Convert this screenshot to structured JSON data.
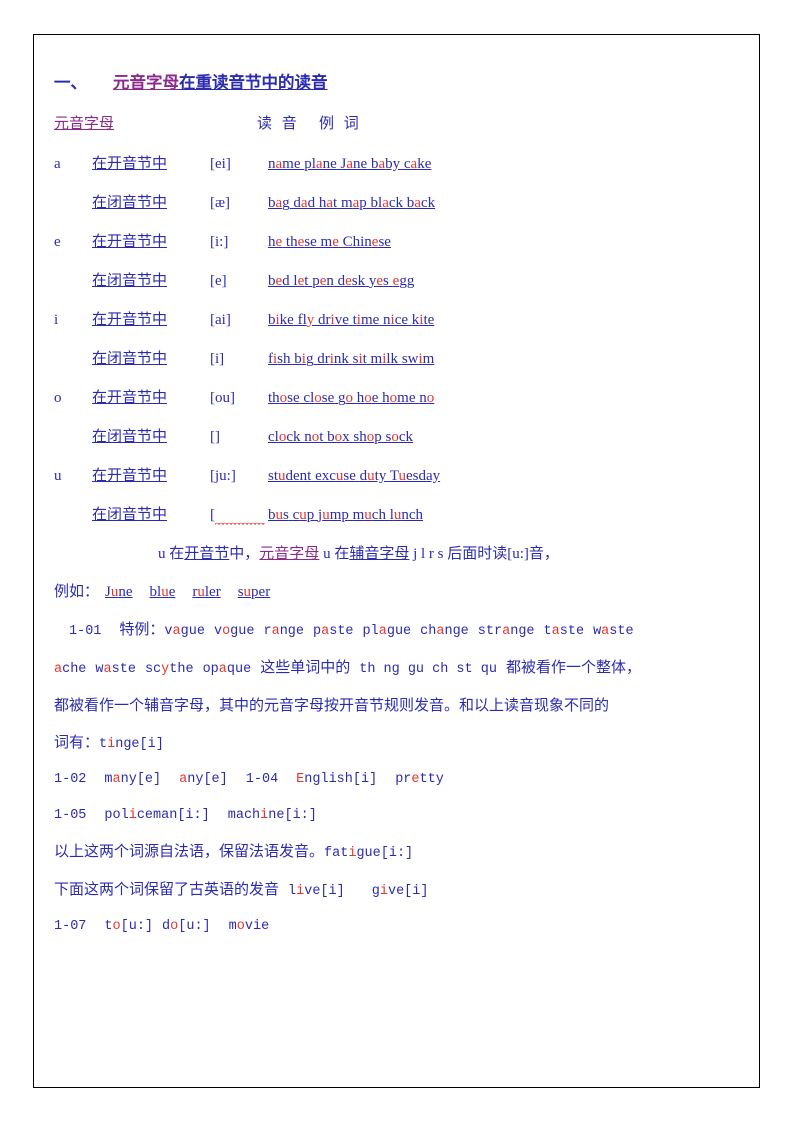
{
  "colors": {
    "blue": "#2b2bb0",
    "red": "#e8352b",
    "purple": "#8b2a8b",
    "border": "#000000",
    "background": "#ffffff"
  },
  "heading": {
    "number": "一、",
    "underlined_part": "元音字母",
    "rest": "在重读音节中的读音"
  },
  "table_header": {
    "vowel_letter": "元音字母",
    "reading": "读 音",
    "example": "例 词"
  },
  "rows": [
    {
      "letter": "a",
      "syllable": "在开音节中",
      "phonetic": "[ei]",
      "examples": [
        {
          "pre": "n",
          "hl": "a",
          "post": "me"
        },
        {
          "pre": "pl",
          "hl": "a",
          "post": "ne"
        },
        {
          "pre": "J",
          "hl": "a",
          "post": "ne"
        },
        {
          "pre": "b",
          "hl": "a",
          "post": "by"
        },
        {
          "pre": "c",
          "hl": "a",
          "post": "ke"
        }
      ]
    },
    {
      "letter": "",
      "syllable": "在闭音节中",
      "phonetic": "[æ]",
      "examples": [
        {
          "pre": "b",
          "hl": "a",
          "post": "g"
        },
        {
          "pre": "d",
          "hl": "a",
          "post": "d"
        },
        {
          "pre": "h",
          "hl": "a",
          "post": "t"
        },
        {
          "pre": "m",
          "hl": "a",
          "post": "p"
        },
        {
          "pre": "bl",
          "hl": "a",
          "post": "ck"
        },
        {
          "pre": "b",
          "hl": "a",
          "post": "ck"
        }
      ]
    },
    {
      "letter": "e",
      "syllable": "在开音节中",
      "phonetic": "[i:]",
      "examples": [
        {
          "pre": "h",
          "hl": "e",
          "post": ""
        },
        {
          "pre": "th",
          "hl": "e",
          "post": "se"
        },
        {
          "pre": "m",
          "hl": "e",
          "post": ""
        },
        {
          "pre": "Chin",
          "hl": "e",
          "post": "se"
        }
      ]
    },
    {
      "letter": "",
      "syllable": "在闭音节中",
      "phonetic": "[e]",
      "examples": [
        {
          "pre": "b",
          "hl": "e",
          "post": "d"
        },
        {
          "pre": "l",
          "hl": "e",
          "post": "t"
        },
        {
          "pre": "p",
          "hl": "e",
          "post": "n"
        },
        {
          "pre": "d",
          "hl": "e",
          "post": "sk"
        },
        {
          "pre": "y",
          "hl": "e",
          "post": "s"
        },
        {
          "pre": "",
          "hl": "e",
          "post": "gg"
        }
      ]
    },
    {
      "letter": "i",
      "syllable": "在开音节中",
      "phonetic": "[ai]",
      "examples": [
        {
          "pre": "b",
          "hl": "i",
          "post": "ke"
        },
        {
          "pre": "fl",
          "hl": "y",
          "post": ""
        },
        {
          "pre": "dr",
          "hl": "i",
          "post": "ve"
        },
        {
          "pre": "t",
          "hl": "i",
          "post": "me"
        },
        {
          "pre": "n",
          "hl": "i",
          "post": "ce"
        },
        {
          "pre": "k",
          "hl": "i",
          "post": "te"
        }
      ]
    },
    {
      "letter": "",
      "syllable": "在闭音节中",
      "phonetic": "[i]",
      "examples": [
        {
          "pre": "f",
          "hl": "i",
          "post": "sh"
        },
        {
          "pre": "b",
          "hl": "i",
          "post": "g"
        },
        {
          "pre": "dr",
          "hl": "i",
          "post": "nk"
        },
        {
          "pre": "s",
          "hl": "i",
          "post": "t"
        },
        {
          "pre": "m",
          "hl": "i",
          "post": "lk"
        },
        {
          "pre": "sw",
          "hl": "i",
          "post": "m"
        }
      ]
    },
    {
      "letter": "o",
      "syllable": "在开音节中",
      "phonetic": "[ou]",
      "examples": [
        {
          "pre": "th",
          "hl": "o",
          "post": "se"
        },
        {
          "pre": "cl",
          "hl": "o",
          "post": "se"
        },
        {
          "pre": "g",
          "hl": "o",
          "post": ""
        },
        {
          "pre": "h",
          "hl": "o",
          "post": "e"
        },
        {
          "pre": "h",
          "hl": "o",
          "post": "me"
        },
        {
          "pre": "n",
          "hl": "o",
          "post": ""
        }
      ]
    },
    {
      "letter": "",
      "syllable": "在闭音节中",
      "phonetic": "[]",
      "examples": [
        {
          "pre": "cl",
          "hl": "o",
          "post": "ck"
        },
        {
          "pre": "n",
          "hl": "o",
          "post": "t"
        },
        {
          "pre": "b",
          "hl": "o",
          "post": "x"
        },
        {
          "pre": "sh",
          "hl": "o",
          "post": "p"
        },
        {
          "pre": "s",
          "hl": "o",
          "post": "ck"
        }
      ]
    },
    {
      "letter": "u",
      "syllable": "在开音节中",
      "phonetic": "[ju:]",
      "examples": [
        {
          "pre": "st",
          "hl": "u",
          "post": "dent"
        },
        {
          "pre": "exc",
          "hl": "u",
          "post": "se"
        },
        {
          "pre": "d",
          "hl": "u",
          "post": "ty"
        },
        {
          "pre": "T",
          "hl": "u",
          "post": "esday"
        }
      ]
    },
    {
      "letter": "",
      "syllable": "在闭音节中",
      "phonetic": "[",
      "phonetic_incomplete": true,
      "examples": [
        {
          "pre": "b",
          "hl": "u",
          "post": "s"
        },
        {
          "pre": "c",
          "hl": "u",
          "post": "p"
        },
        {
          "pre": "j",
          "hl": "u",
          "post": "mp"
        },
        {
          "pre": "m",
          "hl": "u",
          "post": "ch"
        },
        {
          "pre": "l",
          "hl": "u",
          "post": "nch"
        }
      ]
    }
  ],
  "note": {
    "p1_a": "u 在",
    "p1_b": "开音节",
    "p1_c": "中，",
    "p1_d": "元音字母",
    "p1_e": " u 在",
    "p1_f": "辅音字母",
    "p1_g": " j l r s 后面时读[u:]音，",
    "p2_label": "例如：",
    "p2_words": [
      {
        "pre": "J",
        "hl": "u",
        "post": "ne"
      },
      {
        "pre": "bl",
        "hl": "u",
        "post": "e"
      },
      {
        "pre": "r",
        "hl": "u",
        "post": "ler"
      },
      {
        "pre": "s",
        "hl": "u",
        "post": "per"
      }
    ]
  },
  "special": {
    "line1_num": "1-01",
    "line1_label": "特例：",
    "line1_words": [
      {
        "pre": "v",
        "hl": "a",
        "post": "gue"
      },
      {
        "pre": "v",
        "hl": "o",
        "post": "gue"
      },
      {
        "pre": "r",
        "hl": "a",
        "post": "nge"
      },
      {
        "pre": "p",
        "hl": "a",
        "post": "ste"
      },
      {
        "pre": "pl",
        "hl": "a",
        "post": "gue"
      },
      {
        "pre": "ch",
        "hl": "a",
        "post": "nge"
      },
      {
        "pre": "str",
        "hl": "a",
        "post": "nge"
      },
      {
        "pre": "t",
        "hl": "a",
        "post": "ste"
      },
      {
        "pre": "w",
        "hl": "a",
        "post": "ste"
      }
    ],
    "line2_words": [
      {
        "pre": "",
        "hl": "a",
        "post": "che"
      },
      {
        "pre": "w",
        "hl": "a",
        "post": "ste"
      },
      {
        "pre": "sc",
        "hl": "y",
        "post": "the"
      },
      {
        "pre": "op",
        "hl": "a",
        "post": "que"
      }
    ],
    "line2_cn_a": "这些单词中的",
    "line2_mid": "th ng gu ch st qu",
    "line2_cn_b": "都被看作一个整体，",
    "line3": "都被看作一个辅音字母，其中的元音字母按开音节规则发音。和以上读音现象不同的",
    "line4_cn": "词有：",
    "line4_word": {
      "pre": "t",
      "hl": "i",
      "post": "nge[i]"
    },
    "line5_num": "1-02",
    "line5_w1": {
      "pre": "m",
      "hl": "a",
      "post": "ny[e]"
    },
    "line5_w2": {
      "pre": "",
      "hl": "a",
      "post": "ny[e]"
    },
    "line5_num2": "1-04",
    "line5_w3": {
      "pre": "",
      "hl": "E",
      "post": "nglish[i]"
    },
    "line5_w4": {
      "pre": "pr",
      "hl": "e",
      "post": "tty"
    },
    "line6_num": "1-05",
    "line6_w1": {
      "pre": "pol",
      "hl": "i",
      "post": "ceman[i:]"
    },
    "line6_w2": {
      "pre": "mach",
      "hl": "i",
      "post": "ne[i:]"
    },
    "line7_cn": "以上这两个词源自法语，保留法语发音。",
    "line7_word": {
      "pre": "fat",
      "hl": "i",
      "post": "gue[i:]"
    },
    "line8_cn": "下面这两个词保留了古英语的发音",
    "line8_w1": {
      "pre": "l",
      "hl": "i",
      "post": "ve[i]"
    },
    "line8_w2": {
      "pre": "g",
      "hl": "i",
      "post": "ve[i]"
    },
    "line9_num": "1-07",
    "line9_w1": {
      "pre": "t",
      "hl": "o",
      "post": "[u:]"
    },
    "line9_w2": {
      "pre": "d",
      "hl": "o",
      "post": "[u:]"
    },
    "line9_w3": {
      "pre": "m",
      "hl": "o",
      "post": "vie"
    }
  }
}
